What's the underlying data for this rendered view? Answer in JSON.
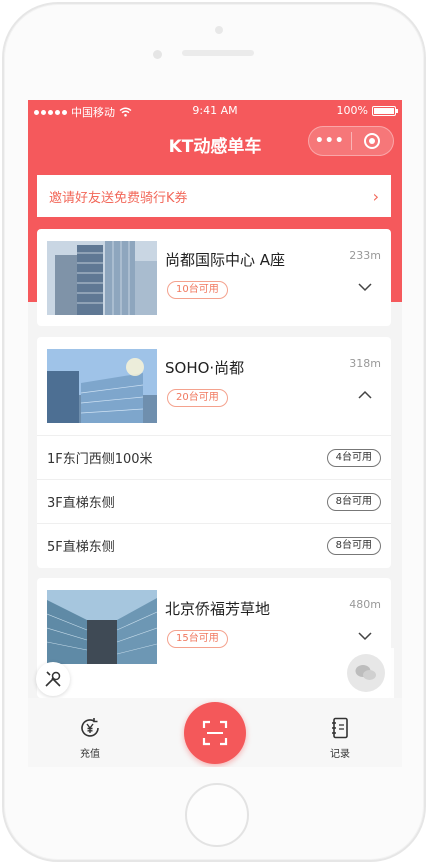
{
  "statusbar": {
    "carrier": "中国移动",
    "time": "9:41 AM",
    "battery": "100%"
  },
  "navbar": {
    "title": "KT动感单车",
    "more": "•••"
  },
  "invite": {
    "text": "邀请好友送免费骑行K券",
    "arrow": "›"
  },
  "locations": [
    {
      "name": "尚都国际中心 A座",
      "distance": "233m",
      "available": "10台可用",
      "expanded": false
    },
    {
      "name": "SOHO·尚都",
      "distance": "318m",
      "available": "20台可用",
      "expanded": true,
      "spots": [
        {
          "label": "1F东门西侧100米",
          "available": "4台可用"
        },
        {
          "label": "3F直梯东侧",
          "available": "8台可用"
        },
        {
          "label": "5F直梯东侧",
          "available": "8台可用"
        }
      ]
    },
    {
      "name": "北京侨福芳草地",
      "distance": "480m",
      "available": "15台可用",
      "expanded": false
    }
  ],
  "bottom": {
    "recharge": "充值",
    "records": "记录"
  },
  "colors": {
    "brand": "#f5595c",
    "accent_text": "#f2685a"
  }
}
